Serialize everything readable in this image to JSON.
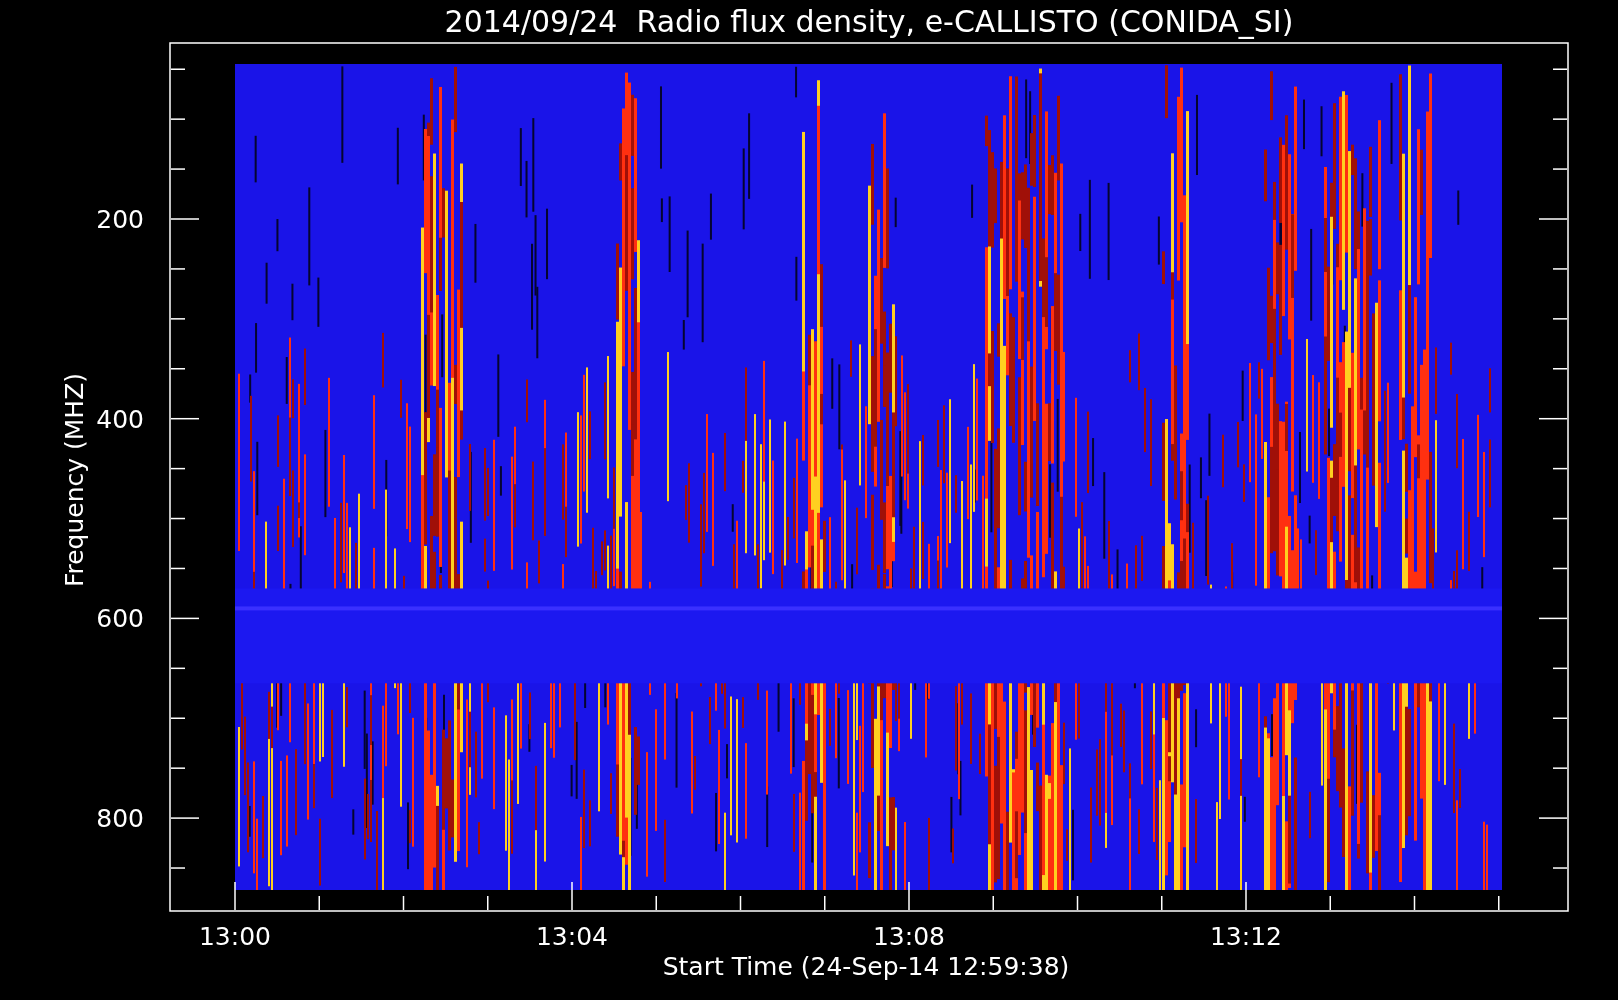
{
  "title": "2014/09/24  Radio flux density, e-CALLISTO (CONIDA_SI)",
  "y_axis": {
    "label": "Frequency (MHZ)",
    "ticks": [
      "200",
      "400",
      "600",
      "800"
    ]
  },
  "x_axis": {
    "label": "Start Time (24-Sep-14 12:59:38)",
    "ticks": [
      "13:00",
      "13:04",
      "13:08",
      "13:12"
    ]
  }
}
